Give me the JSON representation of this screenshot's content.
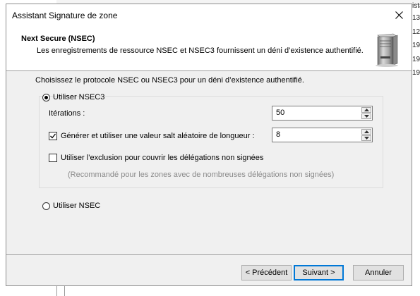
{
  "background": {
    "right_column_fragments": [
      "ista",
      "13,",
      "12,",
      "19,",
      "19,",
      "19,"
    ]
  },
  "dialog": {
    "title": "Assistant Signature de zone",
    "close_glyph": "✕",
    "header": {
      "title": "Next Secure (NSEC)",
      "description": "Les enregistrements de ressource NSEC et NSEC3 fournissent un déni d’existence authentifié.",
      "icon": "server-icon"
    },
    "prompt": "Choisissez le protocole NSEC ou NSEC3 pour un déni d’existence authentifié.",
    "options": {
      "nsec3": {
        "label": "Utiliser NSEC3",
        "selected": true,
        "iterations_label": "Itérations :",
        "iterations_value": "50",
        "salt_label": "Générer et utiliser une valeur salt aléatoire de longueur :",
        "salt_checked": true,
        "salt_length_value": "8",
        "optout_label": "Utiliser l’exclusion pour couvrir les délégations non signées",
        "optout_checked": false,
        "optout_hint": "(Recommandé pour les zones avec de nombreuses délégations non signées)"
      },
      "nsec": {
        "label": "Utiliser NSEC",
        "selected": false
      }
    },
    "buttons": {
      "previous": "< Précédent",
      "next": "Suivant >",
      "cancel": "Annuler"
    },
    "colors": {
      "dialog_bg": "#f0f0f0",
      "default_button_border": "#0078d7"
    }
  }
}
